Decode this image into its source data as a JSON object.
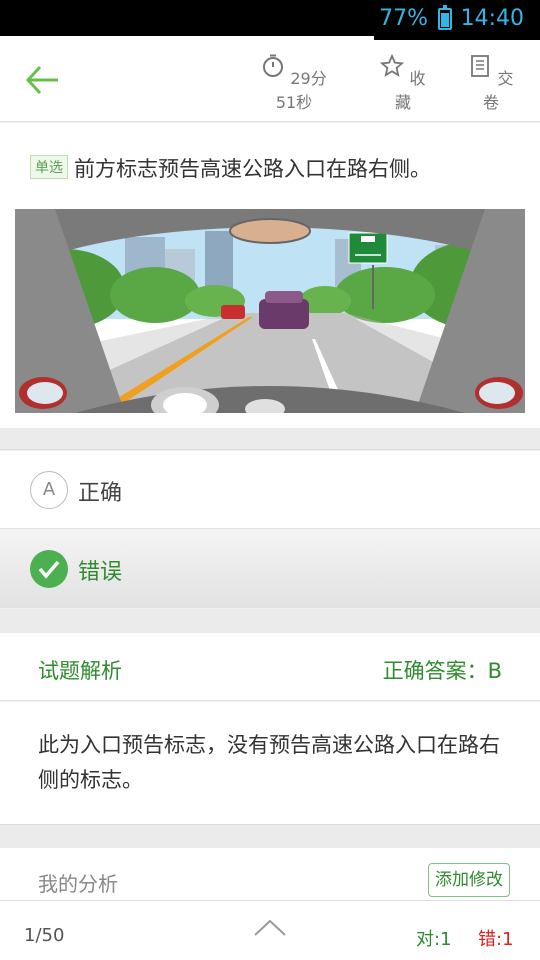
{
  "status_bar": {
    "battery_percent": "77%",
    "time": "14:40",
    "accent_color": "#33b5e5"
  },
  "toolbar": {
    "back_icon": "arrow-left-icon",
    "timer_label": "29分51秒",
    "favorite_label": "收藏",
    "submit_label": "交卷"
  },
  "question": {
    "type_badge": "单选",
    "text": "前方标志预告高速公路入口在路右侧。"
  },
  "options": [
    {
      "letter": "A",
      "text": "正确",
      "state": "unselected"
    },
    {
      "letter": "B",
      "text": "错误",
      "state": "selected-correct"
    }
  ],
  "analysis": {
    "title": "试题解析",
    "answer": "正确答案：B",
    "text": "此为入口预告标志，没有预告高速公路入口在路右侧的标志。"
  },
  "my_analysis": {
    "title": "我的分析",
    "edit_label": "添加修改"
  },
  "footer": {
    "page": "1/50",
    "right": "对:1",
    "wrong": "错:1"
  },
  "colors": {
    "primary_green": "#2e8b2e",
    "check_green": "#4caf50",
    "wrong_red": "#e02020"
  }
}
